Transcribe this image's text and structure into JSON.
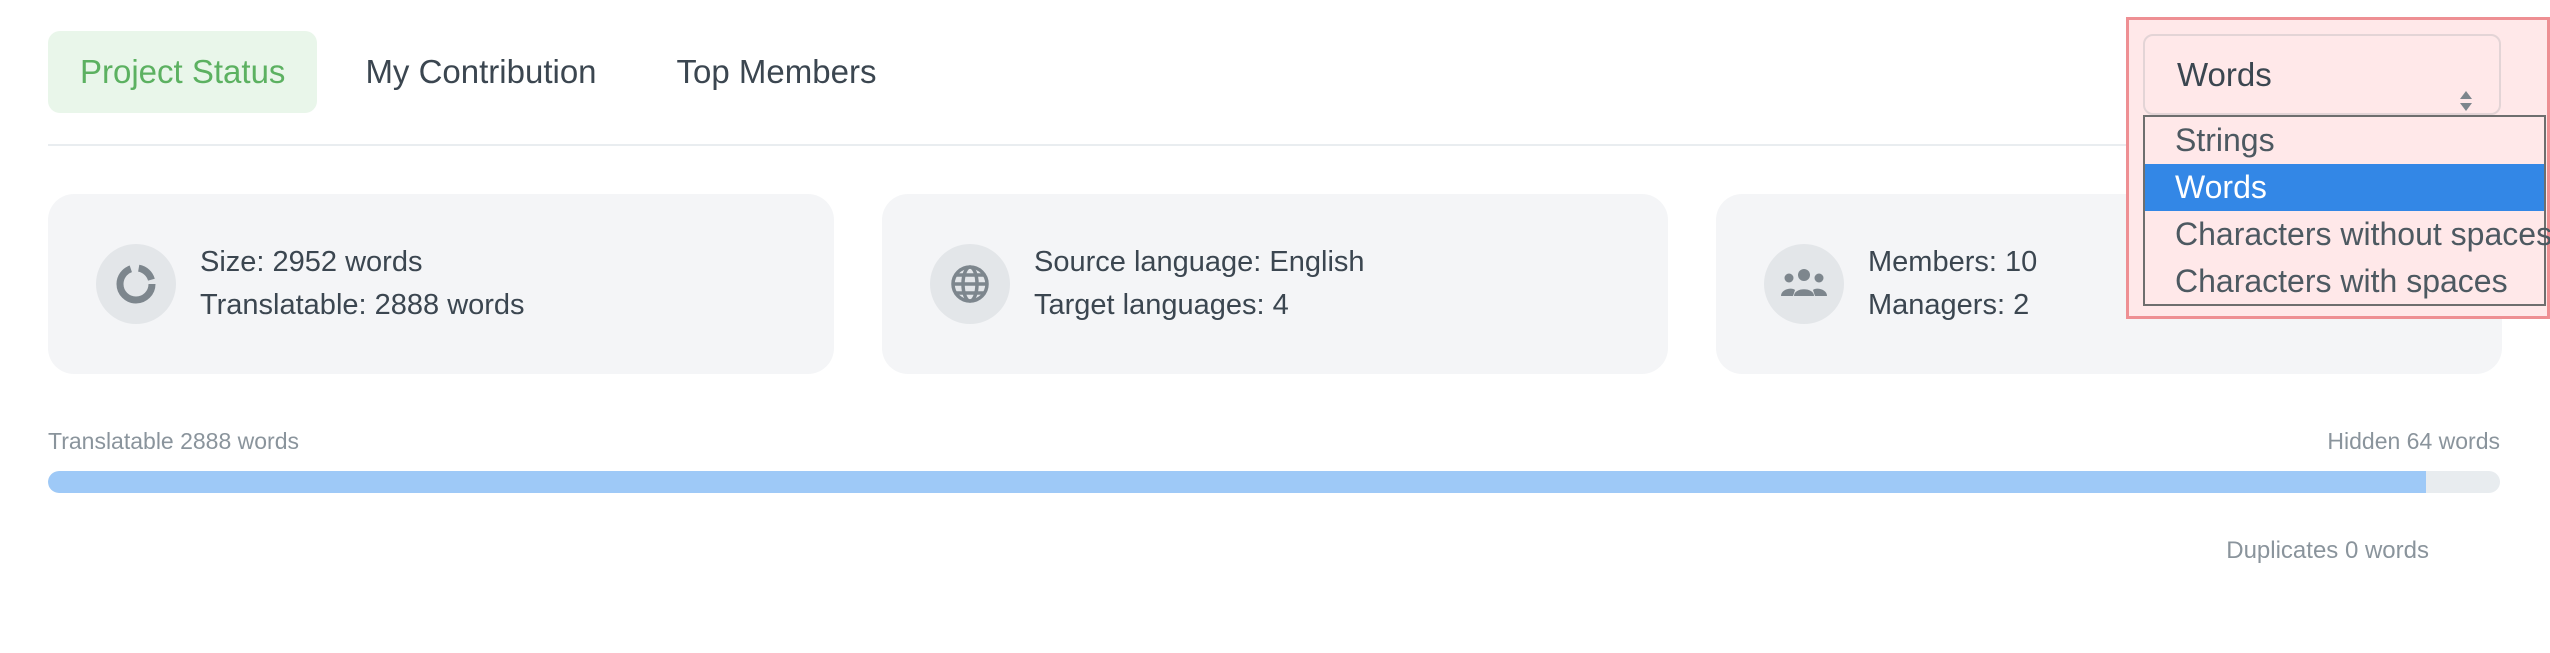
{
  "tabs": [
    {
      "label": "Project Status",
      "active": true
    },
    {
      "label": "My Contribution",
      "active": false
    },
    {
      "label": "Top Members",
      "active": false
    }
  ],
  "cards": [
    {
      "icon": "donut-chart-icon",
      "line1": "Size: 2952 words",
      "line2": "Translatable: 2888 words"
    },
    {
      "icon": "globe-icon",
      "line1": "Source language: English",
      "line2": "Target languages: 4"
    },
    {
      "icon": "members-group-icon",
      "line1": "Members: 10",
      "line2": "Managers: 2"
    }
  ],
  "progress": {
    "left_label": "Translatable 2888 words",
    "right_label": "Hidden 64 words",
    "fill_fraction": 0.97,
    "duplicates_label": "Duplicates 0 words",
    "fill_color": "#9ec9f7"
  },
  "unit_select": {
    "selected": "Words",
    "options": [
      "Strings",
      "Words",
      "Characters without spaces",
      "Characters with spaces"
    ],
    "highlight_color": "#3387e6"
  },
  "colors": {
    "active_tab_text": "#5cb161",
    "active_tab_bg": "#e9f6ea",
    "card_bg": "#f4f5f7"
  }
}
